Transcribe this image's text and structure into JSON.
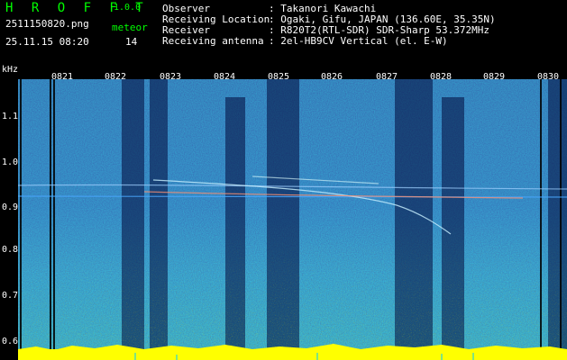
{
  "header": {
    "app_title": "H R O F F T",
    "app_version": "1.0.0",
    "file_name": "2511150820.png",
    "timestamp": "25.11.15 08:20",
    "detect_label": "meteor",
    "detect_count": "14"
  },
  "station": {
    "observer_key": "Observer",
    "observer_value": ": Takanori Kawachi",
    "location_key": "Receiving Location",
    "location_value": ": Ogaki, Gifu, JAPAN (136.60E, 35.35N)",
    "receiver_key": "Receiver",
    "receiver_value": ": R820T2(RTL-SDR) SDR-Sharp 53.372MHz",
    "antenna_key": "Receiving antenna",
    "antenna_value": ": 2el-HB9CV Vertical (el. E-W)"
  },
  "axes": {
    "unit_label": "kHz",
    "y_ticks": [
      "1.1",
      "1.0",
      "0.9",
      "0.8",
      "0.7",
      "0.6"
    ],
    "x_ticks": [
      "0821",
      "0822",
      "0823",
      "0824",
      "0825",
      "0826",
      "0827",
      "0828",
      "0829",
      "0830"
    ]
  },
  "colors": {
    "text_primary": "#00ff00",
    "text_secondary": "#ffffff",
    "background": "#000000",
    "spectrum_base": "#0a1e78",
    "signal_level": "#ffff00"
  }
}
